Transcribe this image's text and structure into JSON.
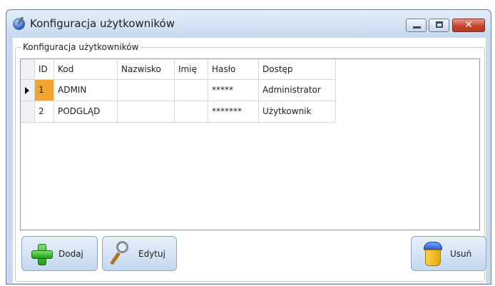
{
  "window": {
    "title": "Konfiguracja użytkowników"
  },
  "group": {
    "label": "Konfiguracja użytkowników"
  },
  "grid": {
    "columns": [
      "ID",
      "Kod",
      "Nazwisko",
      "Imię",
      "Hasło",
      "Dostęp"
    ],
    "rows": [
      {
        "id": "1",
        "kod": "ADMIN",
        "nazwisko": "",
        "imie": "",
        "haslo": "*****",
        "dostep": "Administrator"
      },
      {
        "id": "2",
        "kod": "PODGLĄD",
        "nazwisko": "",
        "imie": "",
        "haslo": "*******",
        "dostep": "Użytkownik"
      }
    ]
  },
  "buttons": {
    "add": "Dodaj",
    "edit": "Edytuj",
    "delete": "Usuń"
  },
  "icons": {
    "app": "user-config-icon",
    "add": "plus-icon",
    "edit": "magnifier-icon",
    "delete": "trash-bin-icon"
  },
  "colors": {
    "selected_cell": "#f2a431",
    "title_bar": "#c9daed",
    "close_button": "#c5452c"
  }
}
